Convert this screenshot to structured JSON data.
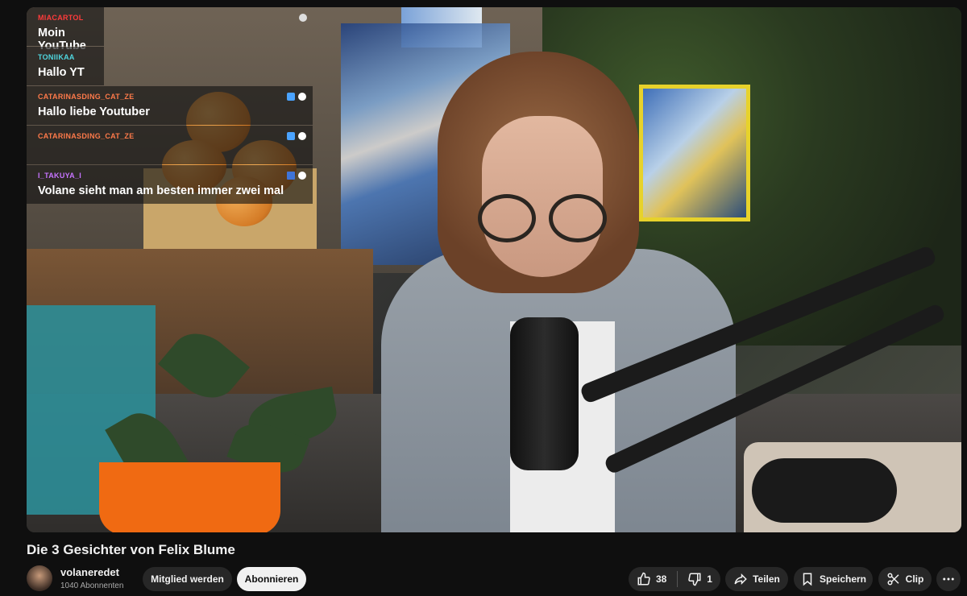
{
  "chat": [
    {
      "user": "MIACARTOL",
      "user_color": "#ff3b3b",
      "text": "Moin YouTube"
    },
    {
      "user": "TONIIKAA",
      "user_color": "#4fd7e0",
      "text": "Hallo YT"
    },
    {
      "user": "CATARINASDING_CAT_ZE",
      "user_color": "#ff7a4a",
      "text": "Hallo liebe Youtuber"
    },
    {
      "user": "CATARINASDING_CAT_ZE",
      "user_color": "#ff7a4a",
      "text": ""
    },
    {
      "user": "I_TAKUYA_I",
      "user_color": "#c774ff",
      "text": "Volane sieht man am besten immer zwei mal"
    }
  ],
  "video": {
    "title": "Die 3 Gesichter von Felix Blume"
  },
  "channel": {
    "name": "volaneredet",
    "subscribers": "1040 Abonnenten"
  },
  "actions": {
    "member_label": "Mitglied werden",
    "subscribe_label": "Abonnieren",
    "likes": "38",
    "dislikes": "1",
    "share_label": "Teilen",
    "save_label": "Speichern",
    "clip_label": "Clip"
  }
}
